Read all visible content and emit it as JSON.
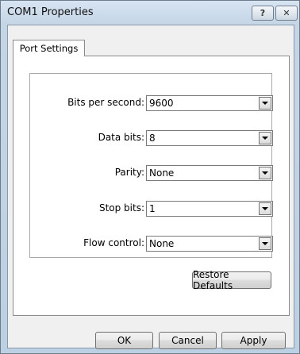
{
  "window": {
    "title": "COM1 Properties",
    "help_label": "?",
    "close_label": "✕"
  },
  "tabs": [
    {
      "label": "Port Settings",
      "active": true
    }
  ],
  "fields": [
    {
      "label": "Bits per second:",
      "value": "9600"
    },
    {
      "label": "Data bits:",
      "value": "8"
    },
    {
      "label": "Parity:",
      "value": "None"
    },
    {
      "label": "Stop bits:",
      "value": "1"
    },
    {
      "label": "Flow control:",
      "value": "None"
    }
  ],
  "buttons": {
    "restore": "Restore Defaults",
    "ok": "OK",
    "cancel": "Cancel",
    "apply": "Apply"
  }
}
